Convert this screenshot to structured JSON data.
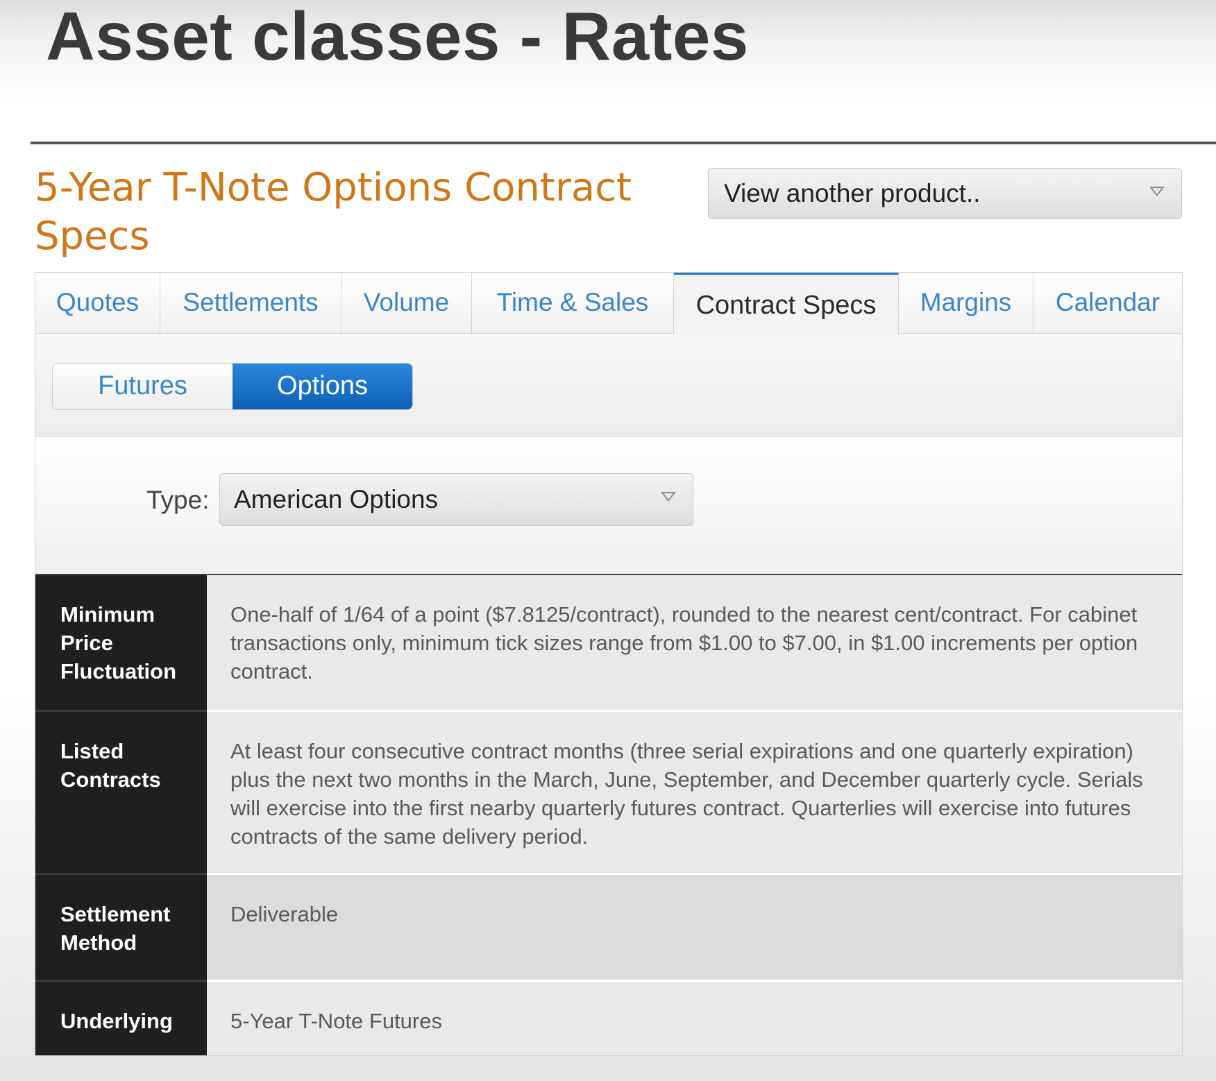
{
  "slide": {
    "title": "Asset classes - Rates"
  },
  "page": {
    "heading": "5-Year T-Note Options Contract Specs"
  },
  "product_select": {
    "value": "View another product.."
  },
  "tabs": [
    {
      "label": "Quotes",
      "active": false
    },
    {
      "label": "Settlements",
      "active": false
    },
    {
      "label": "Volume",
      "active": false
    },
    {
      "label": "Time & Sales",
      "active": false
    },
    {
      "label": "Contract Specs",
      "active": true
    },
    {
      "label": "Margins",
      "active": false
    },
    {
      "label": "Calendar",
      "active": false
    }
  ],
  "toggle": {
    "futures_label": "Futures",
    "options_label": "Options",
    "selected": "Options"
  },
  "type_filter": {
    "label": "Type:",
    "value": "American Options"
  },
  "specs": [
    {
      "label": "Minimum Price Fluctuation",
      "value": "One-half of 1/64 of a point ($7.8125/contract), rounded to the nearest cent/contract. For cabinet transactions only, minimum tick sizes range from $1.00 to $7.00, in $1.00 increments per option contract."
    },
    {
      "label": "Listed Contracts",
      "value": "At least four consecutive contract months (three serial expirations and one quarterly expiration) plus the next two months in the March, June, September, and December quarterly cycle. Serials will exercise into the first nearby quarterly futures contract. Quarterlies will exercise into futures contracts of the same delivery period."
    },
    {
      "label": "Settlement Method",
      "value": "Deliverable"
    },
    {
      "label": "Underlying",
      "value": "5-Year T-Note Futures"
    }
  ],
  "colors": {
    "heading_orange": "#d07818",
    "link_blue": "#3a86c8",
    "active_blue": "#1b70c8",
    "label_dark": "#1f1f1f"
  }
}
